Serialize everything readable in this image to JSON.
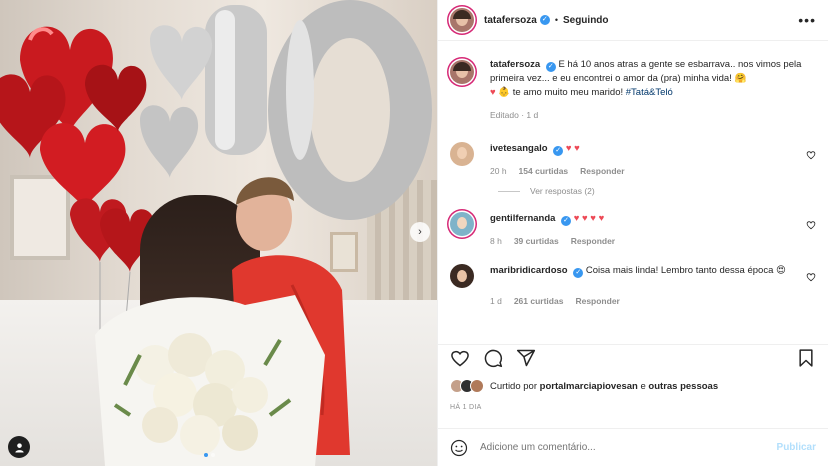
{
  "post": {
    "author": "tatafersoza",
    "separator": "•",
    "follow_status": "Seguindo",
    "more_label": "•••",
    "caption_text": "E há 10 anos atras a gente se esbarrava.. nos vimos pela primeira vez... e eu encontrei o amor da (pra) minha vida! ",
    "caption_emoji_1": "🤗",
    "caption_heart": "♥",
    "caption_emoji_2": "👶",
    "caption_text_2": " te amo muito meu marido! ",
    "caption_hashtag": "#Tatá&Teló",
    "caption_meta": "Editado · 1 d",
    "next_arrow": "›"
  },
  "comments": [
    {
      "user": "ivetesangalo",
      "text": "♥ ♥",
      "time": "20 h",
      "likes": "154 curtidas",
      "reply": "Responder",
      "view_replies": "Ver respostas (2)"
    },
    {
      "user": "gentilfernanda",
      "text": "♥ ♥ ♥ ♥",
      "time": "8 h",
      "likes": "39 curtidas",
      "reply": "Responder"
    },
    {
      "user": "maribridicardoso",
      "text": "Coisa mais linda! Lembro tanto dessa época ",
      "emoji": "😍",
      "time": "1 d",
      "likes": "261 curtidas",
      "reply": "Responder"
    }
  ],
  "likes_line": {
    "prefix": "Curtido por ",
    "user": "portalmarciapiovesan",
    "middle": " e ",
    "others": "outras pessoas"
  },
  "timestamp": "HÁ 1 DIA",
  "add_comment": {
    "placeholder": "Adicione um comentário...",
    "post_label": "Publicar"
  },
  "colors": {
    "accent": "#3897f0",
    "heart": "#ed4956",
    "link": "#00376b",
    "muted": "#8e8e8e",
    "publish_disabled": "#b2dffc"
  }
}
